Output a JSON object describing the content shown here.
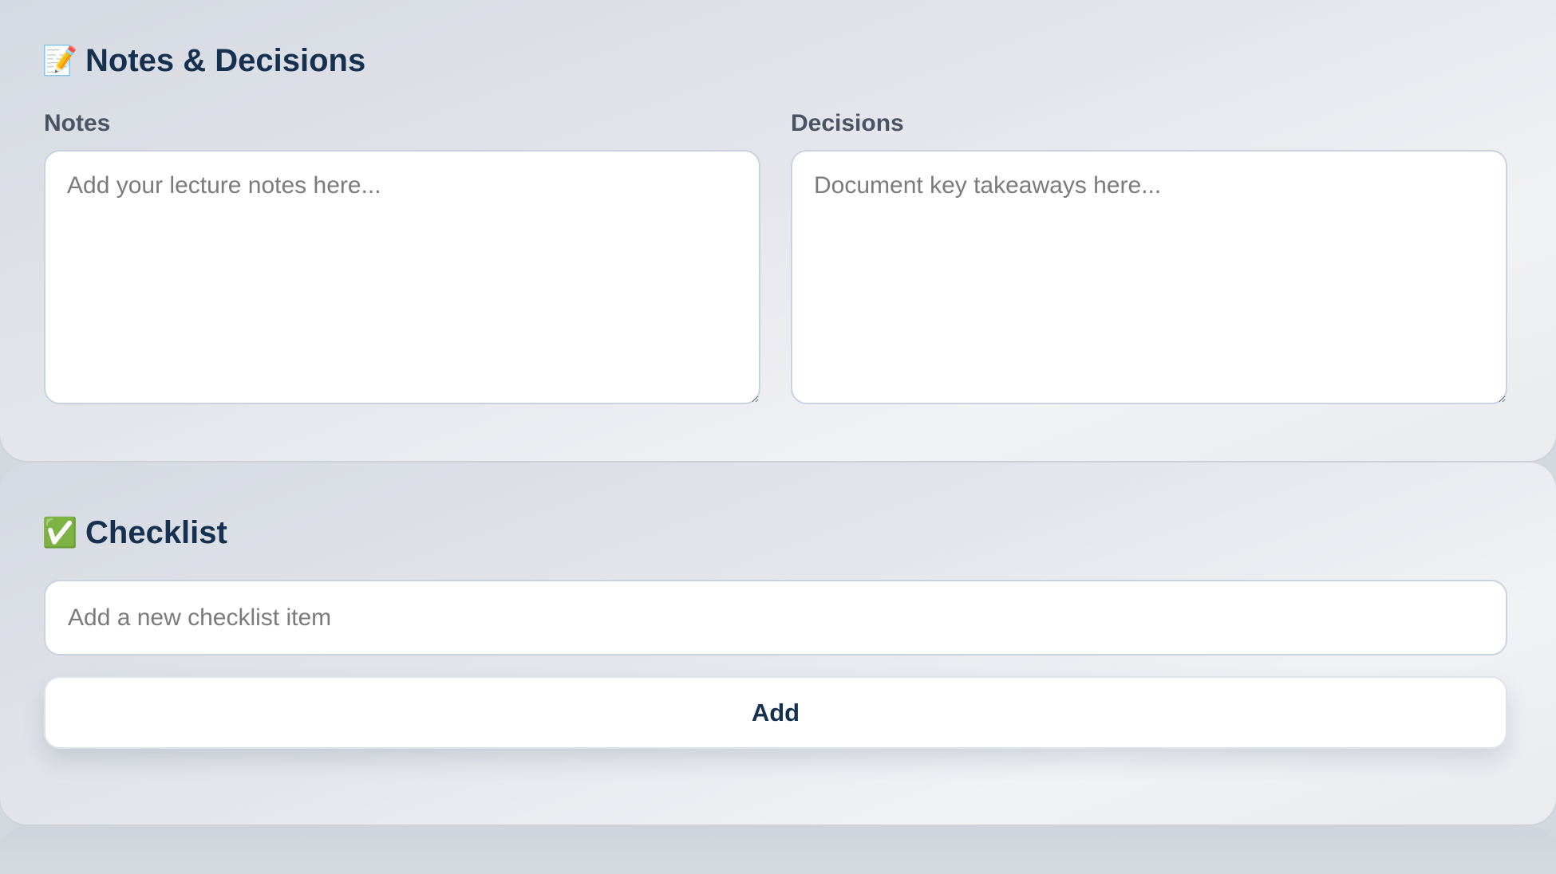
{
  "notes_section": {
    "title_icon": "📝",
    "title": "Notes & Decisions",
    "notes_label": "Notes",
    "notes_placeholder": "Add your lecture notes here...",
    "decisions_label": "Decisions",
    "decisions_placeholder": "Document key takeaways here..."
  },
  "checklist_section": {
    "title_icon": "✅",
    "title": "Checklist",
    "input_placeholder": "Add a new checklist item",
    "add_button_label": "Add"
  },
  "colors": {
    "heading": "#16304f",
    "label": "#4a5363",
    "field_border": "#c9d3df"
  }
}
